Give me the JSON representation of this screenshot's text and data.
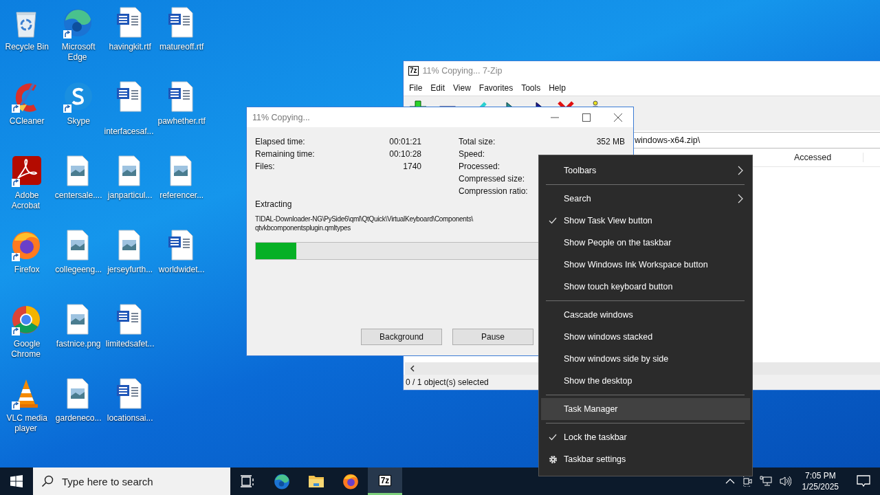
{
  "desktop_icons": [
    {
      "label": "Recycle Bin",
      "kind": "recycle",
      "shortcut": false
    },
    {
      "label": "CCleaner",
      "kind": "ccleaner",
      "shortcut": true
    },
    {
      "label": "Adobe Acrobat",
      "kind": "acrobat",
      "shortcut": true
    },
    {
      "label": "Firefox",
      "kind": "firefox",
      "shortcut": true
    },
    {
      "label": "Google Chrome",
      "kind": "chrome",
      "shortcut": true
    },
    {
      "label": "VLC media player",
      "kind": "vlc",
      "shortcut": true
    },
    {
      "label": "Microsoft Edge",
      "kind": "edge",
      "shortcut": true
    },
    {
      "label": "Skype",
      "kind": "skype",
      "shortcut": true
    },
    {
      "label": "centersale....",
      "kind": "image",
      "shortcut": false
    },
    {
      "label": "collegeeng...",
      "kind": "image",
      "shortcut": false
    },
    {
      "label": "fastnice.png",
      "kind": "image",
      "shortcut": false
    },
    {
      "label": "gardeneco...",
      "kind": "image",
      "shortcut": false
    },
    {
      "label": "havingkit.rtf",
      "kind": "word",
      "shortcut": false
    },
    {
      "label": "interfacesaf...",
      "kind": "word",
      "shortcut": false
    },
    {
      "label": "janparticul...",
      "kind": "image",
      "shortcut": false
    },
    {
      "label": "jerseyfurth...",
      "kind": "image",
      "shortcut": false
    },
    {
      "label": "limitedsafet...",
      "kind": "word",
      "shortcut": false
    },
    {
      "label": "locationsai...",
      "kind": "word",
      "shortcut": false
    },
    {
      "label": "matureoff.rtf",
      "kind": "word",
      "shortcut": false
    },
    {
      "label": "pawhether.rtf",
      "kind": "word",
      "shortcut": false
    },
    {
      "label": "referencer...",
      "kind": "image",
      "shortcut": false
    },
    {
      "label": "worldwidet...",
      "kind": "word",
      "shortcut": false
    }
  ],
  "archive_window": {
    "badge": "7z",
    "title": "11% Copying... 7-Zip",
    "menu": [
      "File",
      "Edit",
      "View",
      "Favorites",
      "Tools",
      "Help"
    ],
    "toolbar": [
      {
        "kind": "add"
      },
      {
        "kind": "extract"
      },
      {
        "kind": "test"
      },
      {
        "kind": "copy"
      },
      {
        "kind": "move"
      },
      {
        "kind": "delete"
      },
      {
        "kind": "info"
      }
    ],
    "path": "windows-x64.zip\\",
    "columns": [
      "Accessed"
    ],
    "status": "0 / 1 object(s) selected"
  },
  "progress_dialog": {
    "title": "11% Copying...",
    "stats_left": [
      {
        "label": "Elapsed time:",
        "value": "00:01:21"
      },
      {
        "label": "Remaining time:",
        "value": "00:10:28"
      },
      {
        "label": "Files:",
        "value": "1740"
      }
    ],
    "stats_right": [
      {
        "label": "Total size:",
        "value": "352 MB"
      },
      {
        "label": "Speed:"
      },
      {
        "label": "Processed:"
      },
      {
        "label": "Compressed size:"
      },
      {
        "label": "Compression ratio:"
      }
    ],
    "operation": "Extracting",
    "file_path": [
      "TIDAL-Downloader-NG\\PySide6\\qml\\QtQuick\\VirtualKeyboard\\Components\\",
      "qtvkbcomponentsplugin.qmltypes"
    ],
    "progress": {
      "level": 0.11
    },
    "buttons": [
      "Background",
      "Pause"
    ]
  },
  "context_menu": {
    "items": [
      {
        "kind": "submenu",
        "label": "Toolbars",
        "checked": false,
        "selected": false
      },
      {
        "kind": "separator"
      },
      {
        "kind": "submenu",
        "label": "Search",
        "checked": false,
        "selected": false
      },
      {
        "kind": "option",
        "label": "Show Task View button",
        "checked": true,
        "selected": false
      },
      {
        "kind": "option",
        "label": "Show People on the taskbar",
        "checked": false,
        "selected": false
      },
      {
        "kind": "option",
        "label": "Show Windows Ink Workspace button",
        "checked": false,
        "selected": false
      },
      {
        "kind": "option",
        "label": "Show touch keyboard button",
        "checked": false,
        "selected": false
      },
      {
        "kind": "separator"
      },
      {
        "kind": "command",
        "label": "Cascade windows",
        "checked": false,
        "selected": false
      },
      {
        "kind": "command",
        "label": "Show windows stacked",
        "checked": false,
        "selected": false
      },
      {
        "kind": "command",
        "label": "Show windows side by side",
        "checked": false,
        "selected": false
      },
      {
        "kind": "command",
        "label": "Show the desktop",
        "checked": false,
        "selected": false
      },
      {
        "kind": "separator"
      },
      {
        "kind": "command",
        "label": "Task Manager",
        "checked": false,
        "selected": true
      },
      {
        "kind": "separator"
      },
      {
        "kind": "option",
        "label": "Lock the taskbar",
        "checked": true,
        "selected": false
      },
      {
        "kind": "settings",
        "label": "Taskbar settings",
        "checked": false,
        "selected": false
      }
    ]
  },
  "taskbar": {
    "search": {
      "placeholder": "Type here to search"
    },
    "apps": [
      {
        "kind": "taskview",
        "active": false
      },
      {
        "kind": "edge",
        "active": false
      },
      {
        "kind": "explorer",
        "active": false
      },
      {
        "kind": "firefox",
        "active": false
      },
      {
        "kind": "sevenzip",
        "active": true,
        "badge": "7z"
      }
    ],
    "tray": {
      "time": "7:05 PM",
      "date": "1/25/2025"
    }
  }
}
